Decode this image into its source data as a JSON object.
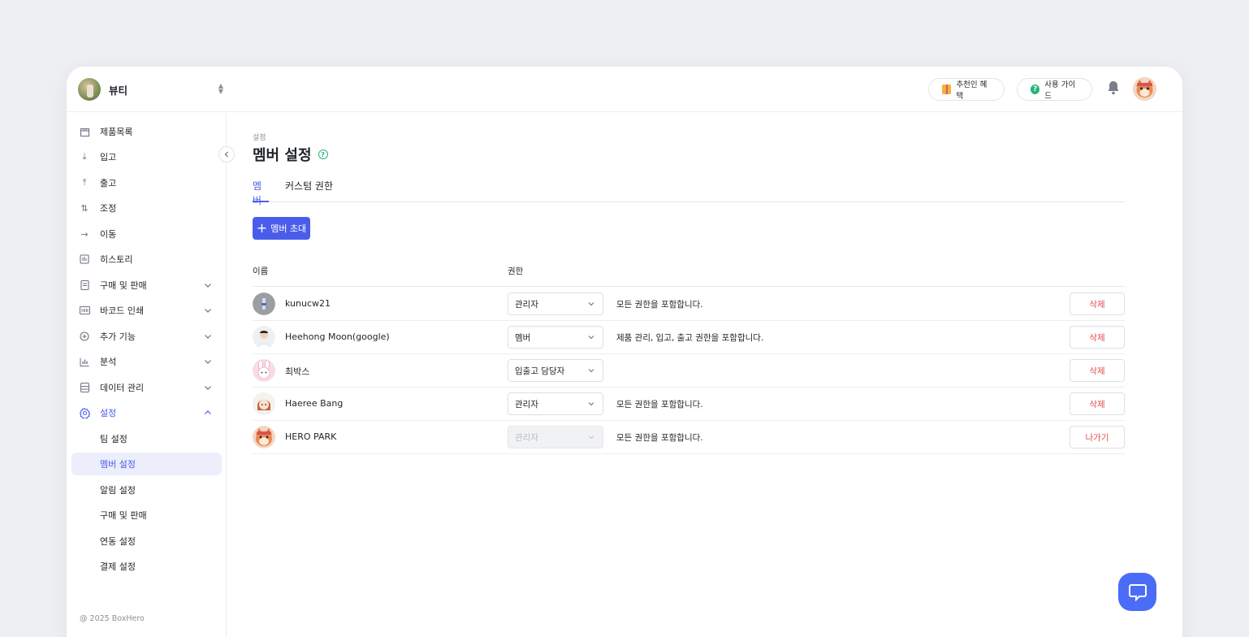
{
  "team": {
    "name": "뷰티"
  },
  "topbar": {
    "referral_label": "추천인 혜택",
    "guide_label": "사용 가이드"
  },
  "sidebar": {
    "items": [
      {
        "label": "제품목록",
        "icon": "box-icon"
      },
      {
        "label": "입고",
        "icon": "arrow-down-icon"
      },
      {
        "label": "출고",
        "icon": "arrow-up-icon"
      },
      {
        "label": "조정",
        "icon": "swap-icon"
      },
      {
        "label": "이동",
        "icon": "arrow-right-icon"
      },
      {
        "label": "히스토리",
        "icon": "history-icon"
      },
      {
        "label": "구매 및 판매",
        "icon": "document-icon"
      },
      {
        "label": "바코드 인쇄",
        "icon": "barcode-icon"
      },
      {
        "label": "추가 기능",
        "icon": "plus-circle-icon"
      },
      {
        "label": "분석",
        "icon": "bar-chart-icon"
      },
      {
        "label": "데이터 관리",
        "icon": "database-icon"
      },
      {
        "label": "설정",
        "icon": "gear-icon"
      }
    ],
    "sub_items": [
      {
        "label": "팀 설정"
      },
      {
        "label": "멤버 설정"
      },
      {
        "label": "알림 설정"
      },
      {
        "label": "구매 및 판매"
      },
      {
        "label": "연동 설정"
      },
      {
        "label": "결제 설정"
      }
    ],
    "copyright": "@ 2025 BoxHero"
  },
  "page": {
    "breadcrumb": "설정",
    "title": "멤버 설정",
    "tabs": [
      {
        "label": "멤버"
      },
      {
        "label": "커스텀 권한"
      }
    ],
    "invite_label": "멤버 초대"
  },
  "table": {
    "headers": {
      "name": "이름",
      "role": "권한"
    },
    "rows": [
      {
        "name": "kunucw21",
        "role": "관리자",
        "desc": "모든 권한을 포함합니다.",
        "action": "삭제"
      },
      {
        "name": "Heehong Moon(google)",
        "role": "멤버",
        "desc": "제품 관리, 입고, 출고 권한을 포함합니다.",
        "action": "삭제"
      },
      {
        "name": "최박스",
        "role": "입출고 담당자",
        "desc": "",
        "action": "삭제"
      },
      {
        "name": "Haeree Bang",
        "role": "관리자",
        "desc": "모든 권한을 포함합니다.",
        "action": "삭제"
      },
      {
        "name": "HERO PARK",
        "role": "관리자",
        "desc": "모든 권한을 포함합니다.",
        "action": "나가기"
      }
    ]
  },
  "colors": {
    "accent": "#4a5dea",
    "danger": "#e5484d",
    "chat": "#4a6cf7"
  }
}
